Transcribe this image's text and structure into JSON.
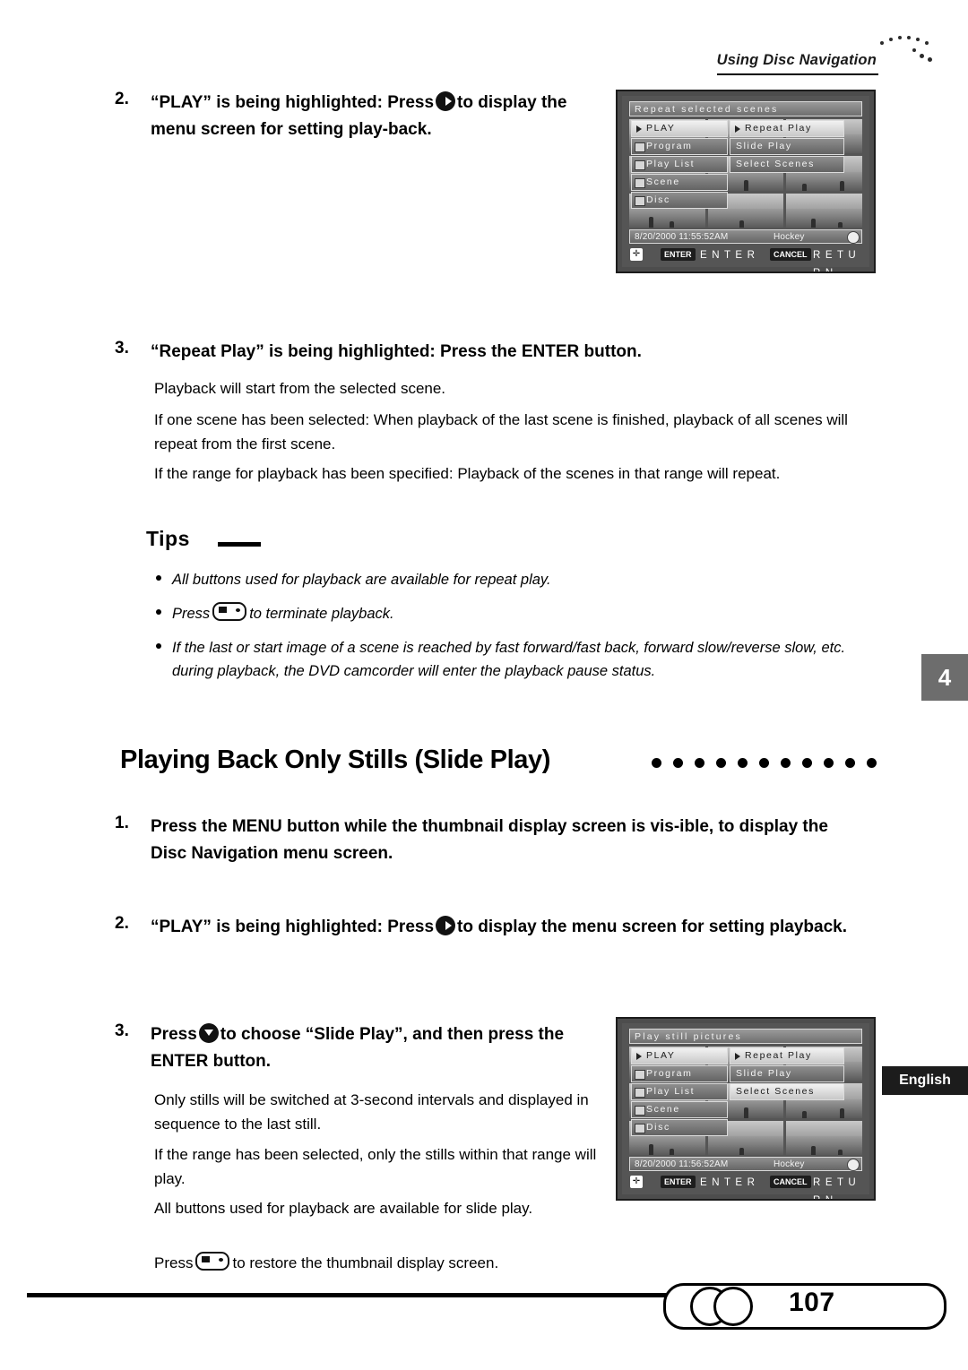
{
  "header": {
    "title": "Using Disc Navigation"
  },
  "steps_top": {
    "step2_num": "2.",
    "step2_text_a": "“PLAY” is being highlighted: Press",
    "step2_text_b": "to display the menu screen for setting play-back.",
    "step3_num": "3.",
    "step3_text": "“Repeat Play” is being highlighted: Press the ENTER button."
  },
  "body_top": {
    "p1": "Playback will start from the selected scene.",
    "p2": "If one scene has been selected: When playback of the last scene is finished, playback of all scenes will repeat from the first scene.",
    "p3": "If the range for playback has been specified: Playback of the scenes in that range will repeat."
  },
  "tips": {
    "heading": "Tips",
    "t1": "All buttons used for playback are available for repeat play.",
    "t2_a": "Press",
    "t2_b": "to terminate playback.",
    "t3": "If the last or start image of a scene is reached by fast forward/fast back, forward slow/reverse slow, etc. during playback, the DVD camcorder will enter the playback pause status."
  },
  "section": {
    "title": "Playing Back Only Stills (Slide Play)"
  },
  "steps_bottom": {
    "step1_num": "1.",
    "step1_text": "Press the MENU button while the thumbnail display screen is vis-ible, to display the Disc Navigation menu screen.",
    "step2_num": "2.",
    "step2_text_a": "“PLAY” is being highlighted: Press",
    "step2_text_b": "to display the menu screen for setting playback.",
    "step3_num": "3.",
    "step3_text_a": "Press",
    "step3_text_b": "to choose “Slide Play”, and then press the ENTER button."
  },
  "body_bottom": {
    "p1": "Only stills will be switched at 3-second intervals and displayed in sequence to the last still.",
    "p2": "If the range has been selected, only the stills within that range will play.",
    "p3": "All buttons used for playback are available for slide play.",
    "p4_a": "Press",
    "p4_b": "to restore the thumbnail display screen."
  },
  "screen_top": {
    "title": "Repeat selected scenes",
    "menu_left": [
      "PLAY",
      "Program",
      "Play List",
      "Scene",
      "Disc"
    ],
    "menu_right": [
      "Repeat Play",
      "Slide Play",
      "Select Scenes"
    ],
    "selected_left": "PLAY",
    "selected_right": "Repeat Play",
    "status_date": "8/20/2000 11:55:52AM",
    "status_label": "Hockey",
    "enter_badge": "ENTER",
    "enter_text": "E N T E R",
    "cancel_badge": "CANCEL",
    "cancel_text": "R E T U R N"
  },
  "screen_bottom": {
    "title": "Play still pictures",
    "menu_left": [
      "PLAY",
      "Program",
      "Play List",
      "Scene",
      "Disc"
    ],
    "menu_right": [
      "Repeat Play",
      "Slide Play",
      "Select Scenes"
    ],
    "selected_left": "PLAY",
    "selected_right": "Select Scenes",
    "status_date": "8/20/2000 11:56:52AM",
    "status_label": "Hockey",
    "enter_badge": "ENTER",
    "enter_text": "E N T E R",
    "cancel_badge": "CANCEL",
    "cancel_text": "R E T U R N"
  },
  "chapter_tab": "4",
  "language_tab": "English",
  "footer": {
    "page_number": "107"
  }
}
